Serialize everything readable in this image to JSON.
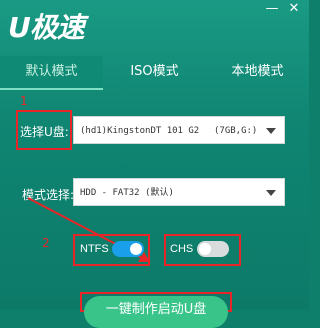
{
  "app": {
    "logo_text": "U极速"
  },
  "window_controls": {
    "minimize": "—",
    "close": "✕"
  },
  "tabs": [
    {
      "label": "默认模式",
      "active": true
    },
    {
      "label": "ISO模式",
      "active": false
    },
    {
      "label": "本地模式",
      "active": false
    }
  ],
  "usb_select": {
    "label": "选择U盘:",
    "value": "(hd1)KingstonDT 101 G2",
    "extra": "(7GB,G:)",
    "icon": "chevron-down-icon"
  },
  "mode_select": {
    "label": "模式选择:",
    "value": "HDD - FAT32 (默认)",
    "icon": "chevron-down-icon"
  },
  "options": [
    {
      "label": "NTFS",
      "enabled": true
    },
    {
      "label": "CHS",
      "enabled": false
    }
  ],
  "annotations": {
    "step1": "1",
    "step2": "2"
  },
  "colors": {
    "background": "#0f8572",
    "highlight": "#e8262a",
    "toggle_on": "#1aa0ea",
    "toggle_off": "#d8dcdc",
    "start_button": "#39c48a"
  },
  "start_button": {
    "label": "一键制作启动U盘"
  }
}
